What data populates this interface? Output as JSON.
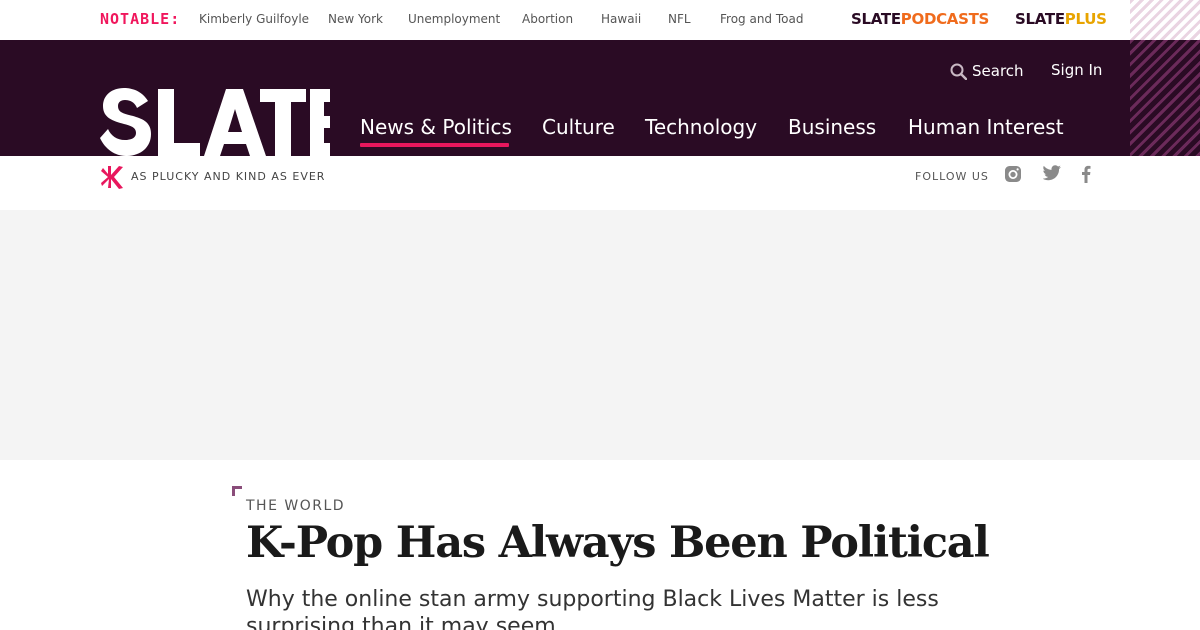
{
  "topbar": {
    "notable_label": "NOTABLE:",
    "trending": [
      "Kimberly Guilfoyle",
      "New York",
      "Unemployment",
      "Abortion",
      "Hawaii",
      "NFL",
      "Frog and Toad"
    ],
    "podcasts_brand": "SLATE",
    "podcasts_suffix": "PODCASTS",
    "plus_brand": "SLATE",
    "plus_suffix": "PLUS"
  },
  "header": {
    "search_label": "Search",
    "signin_label": "Sign In",
    "logo_text": "SLATE",
    "nav": [
      {
        "label": "News & Politics",
        "active": true
      },
      {
        "label": "Culture",
        "active": false
      },
      {
        "label": "Technology",
        "active": false
      },
      {
        "label": "Business",
        "active": false
      },
      {
        "label": "Human Interest",
        "active": false
      }
    ]
  },
  "tagbar": {
    "tagline": "AS PLUCKY AND KIND AS EVER",
    "follow_label": "FOLLOW US",
    "social_icons": [
      "instagram-icon",
      "twitter-icon",
      "facebook-icon"
    ]
  },
  "article": {
    "section": "THE WORLD",
    "headline": "K-Pop Has Always Been Political",
    "dek": "Why the online stan army supporting Black Lives Matter is less surprising than it may seem."
  },
  "colors": {
    "brand_dark": "#2a0b24",
    "accent_pink": "#e8175d",
    "podcasts_orange": "#f06b1c",
    "plus_gold": "#e8a400"
  }
}
